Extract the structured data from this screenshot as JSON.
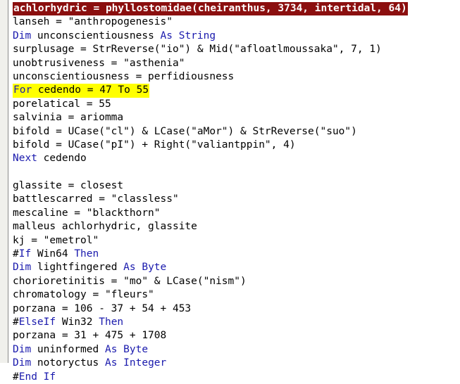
{
  "editor": {
    "name": "vba-code-pane",
    "background_color": "#ffffff",
    "margin_bar_color": "#f0f0ec",
    "keyword_color": "#1a1aad",
    "plain_color": "#000000",
    "highlight_red_bg": "#8b0f0f",
    "highlight_red_fg": "#ffffff",
    "highlight_yellow_bg": "#ffff00",
    "font_size_px": 14.5,
    "line_height_px": 19.4
  },
  "code": {
    "lines": [
      {
        "id": "line-1",
        "highlight": "red",
        "tokens": [
          {
            "t": "achlorhydric = phyllostomidae(cheiranthus, 3734, intertidal, 64)",
            "k": "plain"
          }
        ],
        "text": "achlorhydric = phyllostomidae(cheiranthus, 3734, intertidal, 64)"
      },
      {
        "id": "line-2",
        "highlight": "none",
        "tokens": [
          {
            "t": "lanseh = \"anthropogenesis\"",
            "k": "plain"
          }
        ],
        "text": "lanseh = \"anthropogenesis\""
      },
      {
        "id": "line-3",
        "highlight": "none",
        "tokens": [
          {
            "t": "Dim",
            "k": "keyword"
          },
          {
            "t": " unconscientiousness ",
            "k": "plain"
          },
          {
            "t": "As String",
            "k": "keyword"
          }
        ],
        "text": "Dim unconscientiousness As String"
      },
      {
        "id": "line-4",
        "highlight": "none",
        "tokens": [
          {
            "t": "surplusage = StrReverse(\"io\") & Mid(\"afloatlmoussaka\", 7, 1)",
            "k": "plain"
          }
        ],
        "text": "surplusage = StrReverse(\"io\") & Mid(\"afloatlmoussaka\", 7, 1)"
      },
      {
        "id": "line-5",
        "highlight": "none",
        "tokens": [
          {
            "t": "unobtrusiveness = \"asthenia\"",
            "k": "plain"
          }
        ],
        "text": "unobtrusiveness = \"asthenia\""
      },
      {
        "id": "line-6",
        "highlight": "none",
        "tokens": [
          {
            "t": "unconscientiousness = perfidiousness",
            "k": "plain"
          }
        ],
        "text": "unconscientiousness = perfidiousness"
      },
      {
        "id": "line-7",
        "highlight": "yellow",
        "tokens": [
          {
            "t": "For",
            "k": "keyword"
          },
          {
            "t": " cedendo = 47 ",
            "k": "plain"
          },
          {
            "t": "To",
            "k": "plain"
          },
          {
            "t": " 55",
            "k": "plain"
          }
        ],
        "text": "For cedendo = 47 To 55"
      },
      {
        "id": "line-8",
        "highlight": "none",
        "tokens": [
          {
            "t": "porelatical = 55",
            "k": "plain"
          }
        ],
        "text": "porelatical = 55"
      },
      {
        "id": "line-9",
        "highlight": "none",
        "tokens": [
          {
            "t": "salvinia = ariomma",
            "k": "plain"
          }
        ],
        "text": "salvinia = ariomma"
      },
      {
        "id": "line-10",
        "highlight": "none",
        "tokens": [
          {
            "t": "bifold = UCase(\"cl\") & LCase(\"aMor\") & StrReverse(\"suo\")",
            "k": "plain"
          }
        ],
        "text": "bifold = UCase(\"cl\") & LCase(\"aMor\") & StrReverse(\"suo\")"
      },
      {
        "id": "line-11",
        "highlight": "none",
        "tokens": [
          {
            "t": "bifold = UCase(\"pI\") + Right(\"valiantppin\", 4)",
            "k": "plain"
          }
        ],
        "text": "bifold = UCase(\"pI\") + Right(\"valiantppin\", 4)"
      },
      {
        "id": "line-12",
        "highlight": "none",
        "tokens": [
          {
            "t": "Next",
            "k": "keyword"
          },
          {
            "t": " cedendo",
            "k": "plain"
          }
        ],
        "text": "Next cedendo"
      },
      {
        "id": "line-13",
        "highlight": "none",
        "blank": true,
        "tokens": [],
        "text": ""
      },
      {
        "id": "line-14",
        "highlight": "none",
        "tokens": [
          {
            "t": "glassite = closest",
            "k": "plain"
          }
        ],
        "text": "glassite = closest"
      },
      {
        "id": "line-15",
        "highlight": "none",
        "tokens": [
          {
            "t": "battlescarred = \"classless\"",
            "k": "plain"
          }
        ],
        "text": "battlescarred = \"classless\""
      },
      {
        "id": "line-16",
        "highlight": "none",
        "tokens": [
          {
            "t": "mescaline = \"blackthorn\"",
            "k": "plain"
          }
        ],
        "text": "mescaline = \"blackthorn\""
      },
      {
        "id": "line-17",
        "highlight": "none",
        "tokens": [
          {
            "t": "malleus achlorhydric, glassite",
            "k": "plain"
          }
        ],
        "text": "malleus achlorhydric, glassite"
      },
      {
        "id": "line-18",
        "highlight": "none",
        "tokens": [
          {
            "t": "kj = \"emetrol\"",
            "k": "plain"
          }
        ],
        "text": "kj = \"emetrol\""
      },
      {
        "id": "line-19",
        "highlight": "none",
        "tokens": [
          {
            "t": "#",
            "k": "plain"
          },
          {
            "t": "If",
            "k": "keyword"
          },
          {
            "t": " Win64 ",
            "k": "plain"
          },
          {
            "t": "Then",
            "k": "keyword"
          }
        ],
        "text": "#If Win64 Then"
      },
      {
        "id": "line-20",
        "highlight": "none",
        "tokens": [
          {
            "t": "Dim",
            "k": "keyword"
          },
          {
            "t": " lightfingered ",
            "k": "plain"
          },
          {
            "t": "As Byte",
            "k": "keyword"
          }
        ],
        "text": "Dim lightfingered As Byte"
      },
      {
        "id": "line-21",
        "highlight": "none",
        "tokens": [
          {
            "t": "chorioretinitis = \"mo\" & LCase(\"nism\")",
            "k": "plain"
          }
        ],
        "text": "chorioretinitis = \"mo\" & LCase(\"nism\")"
      },
      {
        "id": "line-22",
        "highlight": "none",
        "tokens": [
          {
            "t": "chromatology = \"fleurs\"",
            "k": "plain"
          }
        ],
        "text": "chromatology = \"fleurs\""
      },
      {
        "id": "line-23",
        "highlight": "none",
        "tokens": [
          {
            "t": "porzana = 106 - 37 + 54 + 453",
            "k": "plain"
          }
        ],
        "text": "porzana = 106 - 37 + 54 + 453"
      },
      {
        "id": "line-24",
        "highlight": "none",
        "tokens": [
          {
            "t": "#",
            "k": "plain"
          },
          {
            "t": "ElseIf",
            "k": "keyword"
          },
          {
            "t": " Win32 ",
            "k": "plain"
          },
          {
            "t": "Then",
            "k": "keyword"
          }
        ],
        "text": "#ElseIf Win32 Then"
      },
      {
        "id": "line-25",
        "highlight": "none",
        "tokens": [
          {
            "t": "porzana = 31 + 475 + 1708",
            "k": "plain"
          }
        ],
        "text": "porzana = 31 + 475 + 1708"
      },
      {
        "id": "line-26",
        "highlight": "none",
        "tokens": [
          {
            "t": "Dim",
            "k": "keyword"
          },
          {
            "t": " uninformed ",
            "k": "plain"
          },
          {
            "t": "As Byte",
            "k": "keyword"
          }
        ],
        "text": "Dim uninformed As Byte"
      },
      {
        "id": "line-27",
        "highlight": "none",
        "tokens": [
          {
            "t": "Dim",
            "k": "keyword"
          },
          {
            "t": " notoryctus ",
            "k": "plain"
          },
          {
            "t": "As Integer",
            "k": "keyword"
          }
        ],
        "text": "Dim notoryctus As Integer"
      },
      {
        "id": "line-28",
        "highlight": "none",
        "tokens": [
          {
            "t": "#",
            "k": "plain"
          },
          {
            "t": "End If",
            "k": "keyword"
          }
        ],
        "text": "#End If"
      }
    ]
  }
}
